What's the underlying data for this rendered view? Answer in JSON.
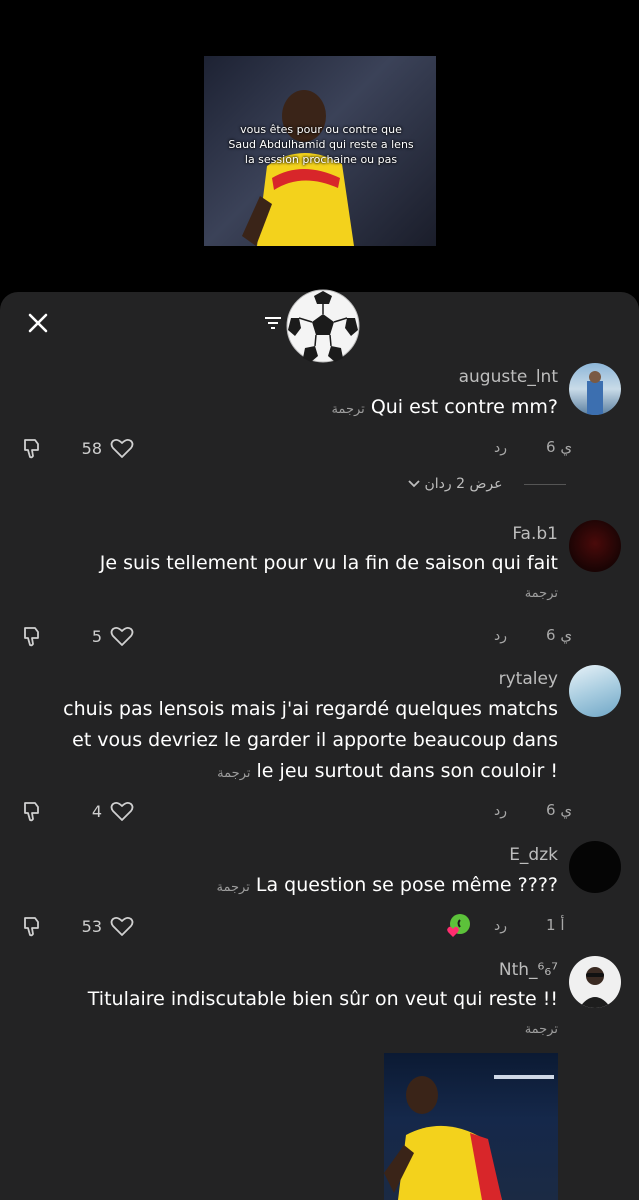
{
  "video": {
    "caption": "vous êtes pour ou contre que Saud Abdulhamid qui reste a lens la session prochaine ou pas"
  },
  "sheet": {
    "close_icon": "close-icon",
    "filter_icon": "filter-icon",
    "ball_emoji": "soccer-ball"
  },
  "comments": [
    {
      "username": "auguste_lnt",
      "text": "Qui est contre mm?",
      "translate": "ترجمة",
      "time": "6 ي",
      "reply": "رد",
      "likes": "58",
      "view_replies": "عرض 2 ردان"
    },
    {
      "username": "Fa.b1",
      "text": "Je suis tellement pour vu la fin de saison qui fait",
      "translate": "ترجمة",
      "time": "6 ي",
      "reply": "رد",
      "likes": "5"
    },
    {
      "username": "rytaley",
      "text_lines": [
        "chuis pas lensois mais j'ai regardé quelques matchs",
        "et vous devriez le garder il apporte beaucoup dans",
        "le jeu surtout dans son couloir !"
      ],
      "translate": "ترجمة",
      "time": "6 ي",
      "reply": "رد",
      "likes": "4"
    },
    {
      "username": "E_dzk",
      "text": "La question se pose même ????",
      "translate": "ترجمة",
      "time": "1 أ",
      "reply": "رد",
      "likes": "53"
    },
    {
      "username": "Nth_⁶₆⁷",
      "text": "Titulaire indiscutable bien sûr on veut qui reste !!",
      "translate": "ترجمة"
    }
  ],
  "colors": {
    "sheet_bg": "#232324",
    "text_secondary": "#a8a8a8",
    "lens_yellow": "#f3d21c",
    "lens_red": "#d8262a"
  }
}
